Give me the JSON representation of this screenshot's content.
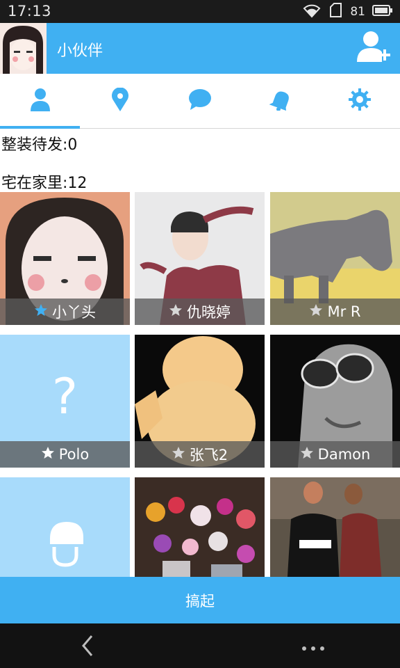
{
  "status_bar": {
    "time": "17:13",
    "battery": "81",
    "icons": [
      "wifi-icon",
      "sim-icon",
      "battery-icon"
    ]
  },
  "header": {
    "title": "小伙伴",
    "avatar_icon": "cartoon-girl-avatar",
    "action_icon": "add-user-icon"
  },
  "tabs": [
    {
      "icon": "person-icon",
      "selected": true
    },
    {
      "icon": "location-pin-icon",
      "selected": false
    },
    {
      "icon": "chat-bubble-icon",
      "selected": false
    },
    {
      "icon": "bell-icon",
      "selected": false
    },
    {
      "icon": "gear-icon",
      "selected": false
    }
  ],
  "sections": {
    "pending": "整装待发:0",
    "home": "宅在家里:12"
  },
  "friends": [
    {
      "name": "小丫头",
      "starred": true,
      "image": "cartoon-girl"
    },
    {
      "name": "仇晓婷",
      "starred": false,
      "image": "girl-photo"
    },
    {
      "name": "Mr R",
      "starred": false,
      "image": "horse-photo"
    },
    {
      "name": "Polo",
      "starred": false,
      "image": "question-mark"
    },
    {
      "name": "张飞2",
      "starred": false,
      "image": "blurred-yellow"
    },
    {
      "name": "Damon",
      "starred": false,
      "image": "man-sunglasses"
    },
    {
      "name": "",
      "starred": false,
      "image": "default-avatar"
    },
    {
      "name": "",
      "starred": false,
      "image": "flowers-photo"
    },
    {
      "name": "",
      "starred": false,
      "image": "two-people-photo"
    }
  ],
  "bottom_button": "搞起",
  "colors": {
    "accent": "#40b0f2",
    "tile_light": "#a8dbfb"
  }
}
